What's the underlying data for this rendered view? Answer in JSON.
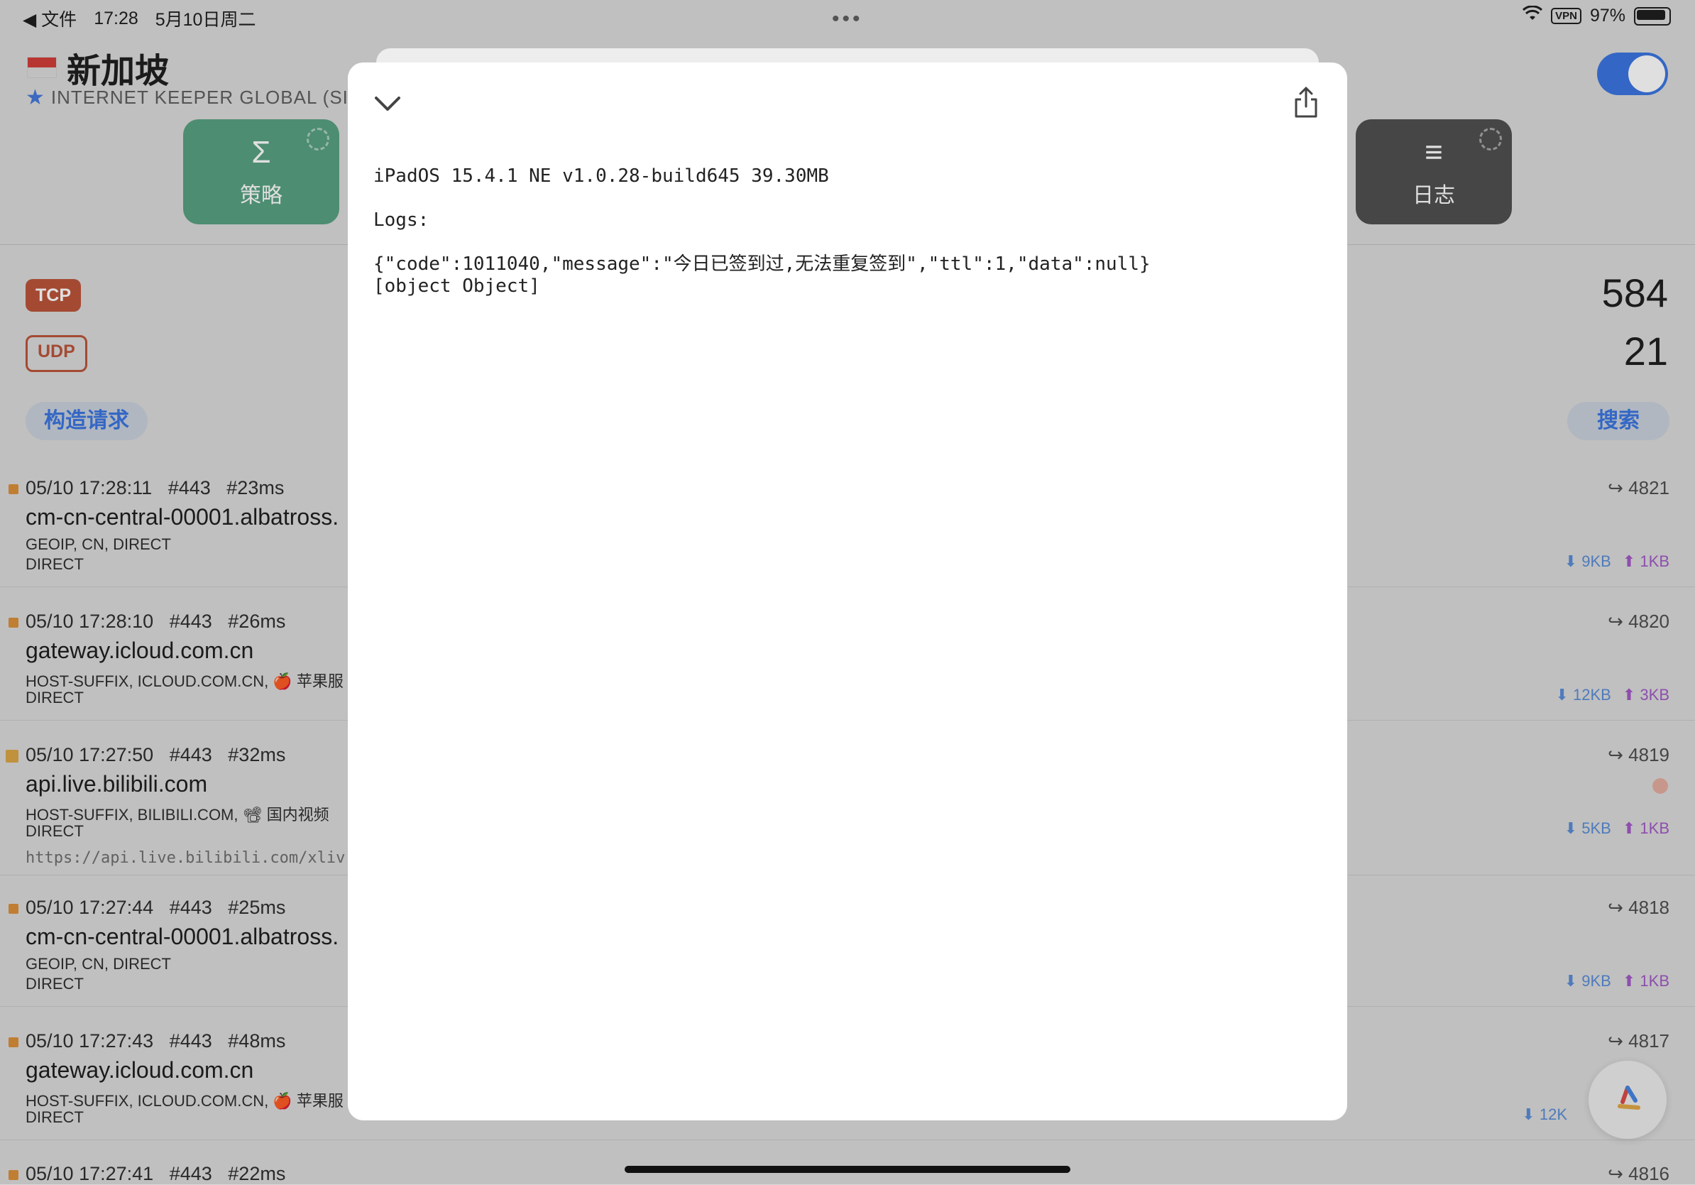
{
  "status_bar": {
    "back_label": "◀ 文件",
    "time": "17:28",
    "date": "5月10日周二",
    "vpn": "VPN",
    "battery": "97%"
  },
  "header": {
    "title": "新加坡",
    "subtitle": "INTERNET KEEPER GLOBAL (SINC",
    "policy_label": "策略",
    "log_label": "日志"
  },
  "stats": {
    "tcp_label": "TCP",
    "udp_label": "UDP",
    "tcp_count": "584",
    "udp_count": "21",
    "build_request": "构造请求",
    "search": "搜索"
  },
  "requests": [
    {
      "time": "05/10 17:28:11",
      "port": "#443",
      "latency": "#23ms",
      "host": "cm-cn-central-00001.albatross.",
      "rule": "GEOIP, CN, DIRECT",
      "policy": "DIRECT",
      "id": "↪ 4821",
      "down": "9KB",
      "up": "1KB",
      "url": ""
    },
    {
      "time": "05/10 17:28:10",
      "port": "#443",
      "latency": "#26ms",
      "host": "gateway.icloud.com.cn",
      "rule": "HOST-SUFFIX, ICLOUD.COM.CN, 🍎 苹果服",
      "policy": "DIRECT",
      "id": "↪ 4820",
      "down": "12KB",
      "up": "3KB",
      "url": ""
    },
    {
      "time": "05/10 17:27:50",
      "port": "#443",
      "latency": "#32ms",
      "host": "api.live.bilibili.com",
      "rule": "HOST-SUFFIX, BILIBILI.COM, 📽 国内视频",
      "policy": "DIRECT",
      "id": "↪ 4819",
      "down": "5KB",
      "up": "1KB",
      "url": "https://api.live.bilibili.com/xliv"
    },
    {
      "time": "05/10 17:27:44",
      "port": "#443",
      "latency": "#25ms",
      "host": "cm-cn-central-00001.albatross.",
      "rule": "GEOIP, CN, DIRECT",
      "policy": "DIRECT",
      "id": "↪ 4818",
      "down": "9KB",
      "up": "1KB",
      "url": ""
    },
    {
      "time": "05/10 17:27:43",
      "port": "#443",
      "latency": "#48ms",
      "host": "gateway.icloud.com.cn",
      "rule": "HOST-SUFFIX, ICLOUD.COM.CN, 🍎 苹果服",
      "policy": "DIRECT",
      "id": "↪ 4817",
      "down": "12K",
      "up": "",
      "url": ""
    },
    {
      "time": "05/10 17:27:41",
      "port": "#443",
      "latency": "#22ms",
      "host": "",
      "rule": "",
      "policy": "",
      "id": "↪ 4816",
      "down": "",
      "up": "",
      "url": ""
    }
  ],
  "modal": {
    "log_text": "iPadOS 15.4.1 NE v1.0.28-build645 39.30MB\n\nLogs:\n\n{\"code\":1011040,\"message\":\"今日已签到过,无法重复签到\",\"ttl\":1,\"data\":null}\n[object Object]"
  },
  "colors": {
    "accent": "#2f6de0",
    "policy_card": "#4e9b7a",
    "log_card": "#454545",
    "tcp": "#b84a2e",
    "download": "#4f85d5",
    "upload": "#9b4fc3"
  }
}
